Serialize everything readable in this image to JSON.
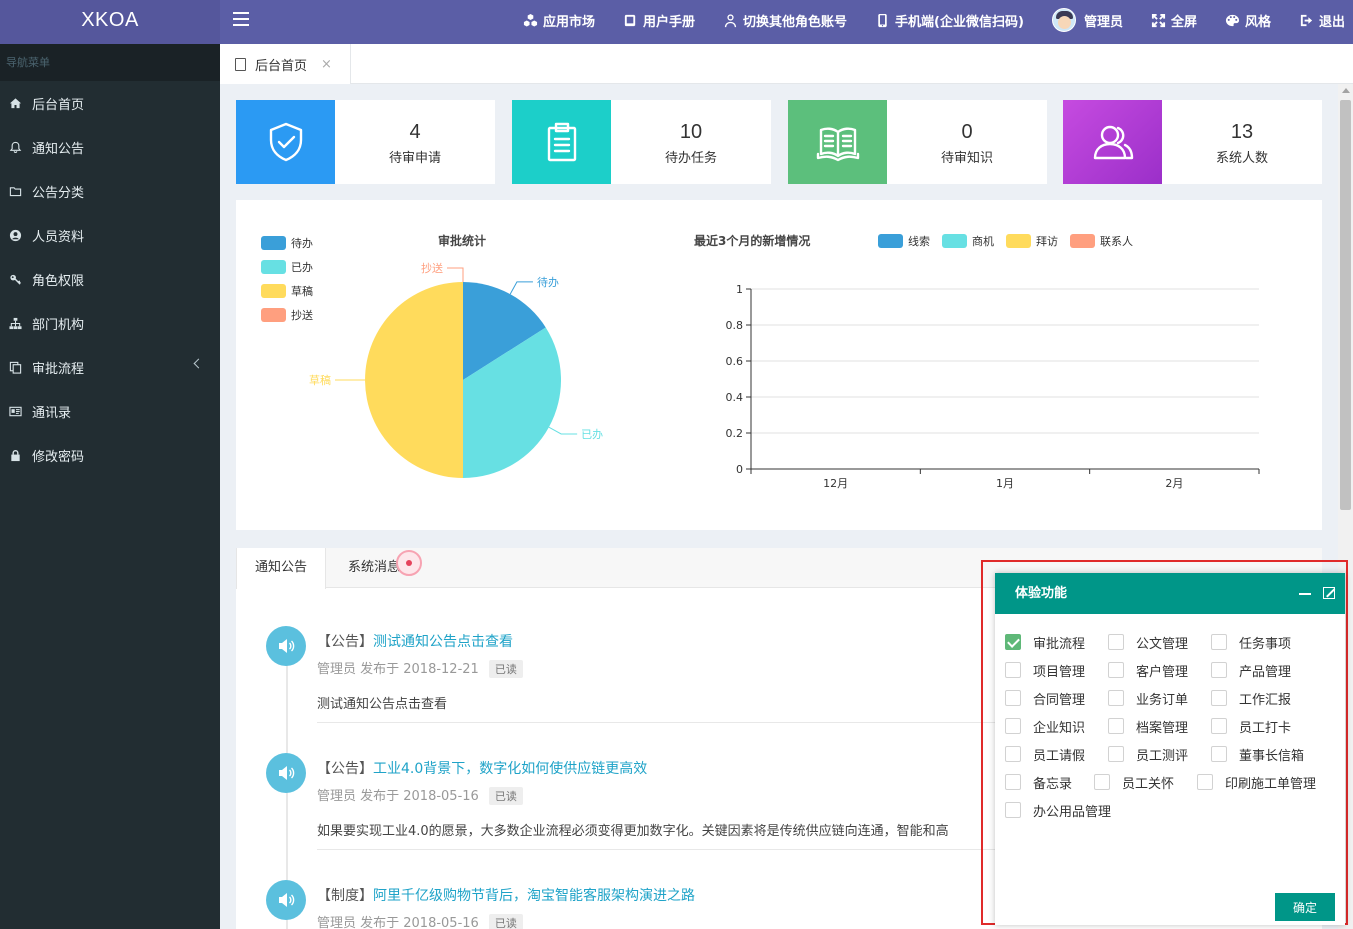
{
  "app": {
    "title": "XKOA"
  },
  "topnav": {
    "items": [
      {
        "label": "应用市场",
        "icon": "cubes-icon"
      },
      {
        "label": "用户手册",
        "icon": "book-icon"
      },
      {
        "label": "切换其他角色账号",
        "icon": "user-switch-icon"
      },
      {
        "label": "手机端(企业微信扫码)",
        "icon": "mobile-icon"
      },
      {
        "label": "管理员",
        "icon": "avatar"
      },
      {
        "label": "全屏",
        "icon": "expand-icon"
      },
      {
        "label": "风格",
        "icon": "palette-icon"
      },
      {
        "label": "退出",
        "icon": "logout-icon"
      }
    ]
  },
  "sidebar": {
    "header": "导航菜单",
    "items": [
      {
        "label": "后台首页",
        "icon": "home-icon"
      },
      {
        "label": "通知公告",
        "icon": "bell-icon"
      },
      {
        "label": "公告分类",
        "icon": "folder-icon"
      },
      {
        "label": "人员资料",
        "icon": "user-circle-icon"
      },
      {
        "label": "角色权限",
        "icon": "key-icon"
      },
      {
        "label": "部门机构",
        "icon": "sitemap-icon"
      },
      {
        "label": "审批流程",
        "icon": "copy-icon"
      },
      {
        "label": "通讯录",
        "icon": "id-card-icon"
      },
      {
        "label": "修改密码",
        "icon": "lock-icon"
      }
    ]
  },
  "tabs": {
    "home_label": "后台首页",
    "close_glyph": "×"
  },
  "stats": [
    {
      "value": "4",
      "label": "待审申请",
      "color": "#2b9af3",
      "icon": "shield-check-icon"
    },
    {
      "value": "10",
      "label": "待办任务",
      "color": "#1ccfc9",
      "icon": "clipboard-icon"
    },
    {
      "value": "0",
      "label": "待审知识",
      "color": "#5cbf7c",
      "icon": "open-book-icon"
    },
    {
      "value": "13",
      "label": "系统人数",
      "color": "#b23fd6",
      "icon": "users-icon"
    }
  ],
  "chart_data": [
    {
      "type": "pie",
      "title": "审批统计",
      "legend": [
        "待办",
        "已办",
        "草稿",
        "抄送"
      ],
      "legend_position": "top-left",
      "colors": [
        "#3a9fd9",
        "#67e0e3",
        "#ffdb5c",
        "#ff9f7f"
      ],
      "values": [
        1.6,
        3.4,
        5,
        0
      ]
    },
    {
      "type": "line",
      "title": "最近3个月的新增情况",
      "legend_position": "top",
      "categories": [
        "12月",
        "1月",
        "2月"
      ],
      "ylim": [
        0,
        1
      ],
      "yticks": [
        "0",
        "0.2",
        "0.4",
        "0.6",
        "0.8",
        "1"
      ],
      "grid": true,
      "series": [
        {
          "name": "线索",
          "color": "#3a9fd9",
          "values": [
            0,
            0,
            0
          ]
        },
        {
          "name": "商机",
          "color": "#67e0e3",
          "values": [
            0,
            0,
            0
          ]
        },
        {
          "name": "拜访",
          "color": "#ffdb5c",
          "values": [
            0,
            0,
            0
          ]
        },
        {
          "name": "联系人",
          "color": "#ff9f7f",
          "values": [
            0,
            0,
            0
          ]
        }
      ]
    }
  ],
  "notice": {
    "tabs": [
      "通知公告",
      "系统消息"
    ],
    "items": [
      {
        "category": "【公告】",
        "title": "测试通知公告点击查看",
        "meta": "管理员 发布于 2018-12-21",
        "status": "已读",
        "body": "测试通知公告点击查看"
      },
      {
        "category": "【公告】",
        "title": "工业4.0背景下，数字化如何使供应链更高效",
        "meta": "管理员 发布于 2018-05-16",
        "status": "已读",
        "body": "如果要实现工业4.0的愿景，大多数企业流程必须变得更加数字化。关键因素将是传统供应链向连通，智能和高"
      },
      {
        "category": "【制度】",
        "title": "阿里千亿级购物节背后，淘宝智能客服架构演进之路",
        "meta": "管理员 发布于 2018-05-16",
        "status": "已读",
        "body": ""
      }
    ]
  },
  "popup": {
    "title": "体验功能",
    "confirm": "确定",
    "features": [
      {
        "label": "审批流程",
        "checked": true
      },
      {
        "label": "公文管理",
        "checked": false
      },
      {
        "label": "任务事项",
        "checked": false
      },
      {
        "label": "项目管理",
        "checked": false
      },
      {
        "label": "客户管理",
        "checked": false
      },
      {
        "label": "产品管理",
        "checked": false
      },
      {
        "label": "合同管理",
        "checked": false
      },
      {
        "label": "业务订单",
        "checked": false
      },
      {
        "label": "工作汇报",
        "checked": false
      },
      {
        "label": "企业知识",
        "checked": false
      },
      {
        "label": "档案管理",
        "checked": false
      },
      {
        "label": "员工打卡",
        "checked": false
      },
      {
        "label": "员工请假",
        "checked": false
      },
      {
        "label": "员工测评",
        "checked": false
      },
      {
        "label": "董事长信箱",
        "checked": false
      },
      {
        "label": "备忘录",
        "checked": false
      },
      {
        "label": "员工关怀",
        "checked": false
      },
      {
        "label": "印刷施工单管理",
        "checked": false
      },
      {
        "label": "办公用品管理",
        "checked": false
      }
    ]
  }
}
